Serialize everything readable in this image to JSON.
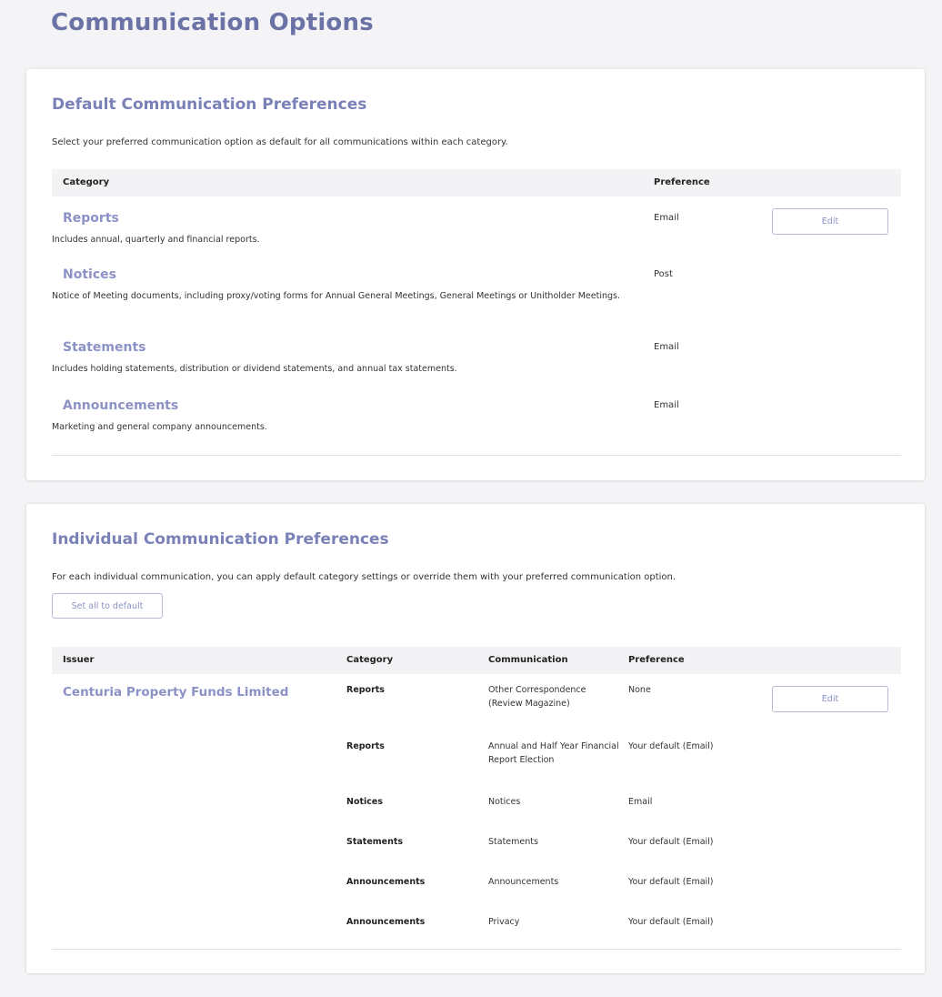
{
  "page": {
    "title": "Communication Options"
  },
  "default_prefs": {
    "title": "Default Communication Preferences",
    "intro": "Select your preferred communication option as default for all communications within each category.",
    "headers": {
      "category": "Category",
      "preference": "Preference"
    },
    "edit_label": "Edit",
    "rows": [
      {
        "name": "Reports",
        "description": "Includes annual, quarterly and financial reports.",
        "preference": "Email"
      },
      {
        "name": "Notices",
        "description": "Notice of Meeting documents, including proxy/voting forms for Annual General Meetings, General Meetings or Unitholder Meetings.",
        "preference": "Post"
      },
      {
        "name": "Statements",
        "description": "Includes holding statements, distribution or dividend statements, and annual tax statements.",
        "preference": "Email"
      },
      {
        "name": "Announcements",
        "description": "Marketing and general company announcements.",
        "preference": "Email"
      }
    ]
  },
  "individual_prefs": {
    "title": "Individual Communication Preferences",
    "intro": "For each individual communication, you can apply default category settings or override them with your preferred communication option.",
    "set_default_label": "Set all to default",
    "headers": {
      "issuer": "Issuer",
      "category": "Category",
      "communication": "Communication",
      "preference": "Preference"
    },
    "issuer": "Centuria Property Funds Limited",
    "edit_label": "Edit",
    "rows": [
      {
        "category": "Reports",
        "communication": "Other Correspondence (Review Magazine)",
        "preference": "None"
      },
      {
        "category": "Reports",
        "communication": "Annual and Half Year Financial Report Election",
        "preference": "Your default (Email)"
      },
      {
        "category": "Notices",
        "communication": "Notices",
        "preference": "Email"
      },
      {
        "category": "Statements",
        "communication": "Statements",
        "preference": "Your default (Email)"
      },
      {
        "category": "Announcements",
        "communication": "Announcements",
        "preference": "Your default (Email)"
      },
      {
        "category": "Announcements",
        "communication": "Privacy",
        "preference": "Your default (Email)"
      }
    ]
  }
}
